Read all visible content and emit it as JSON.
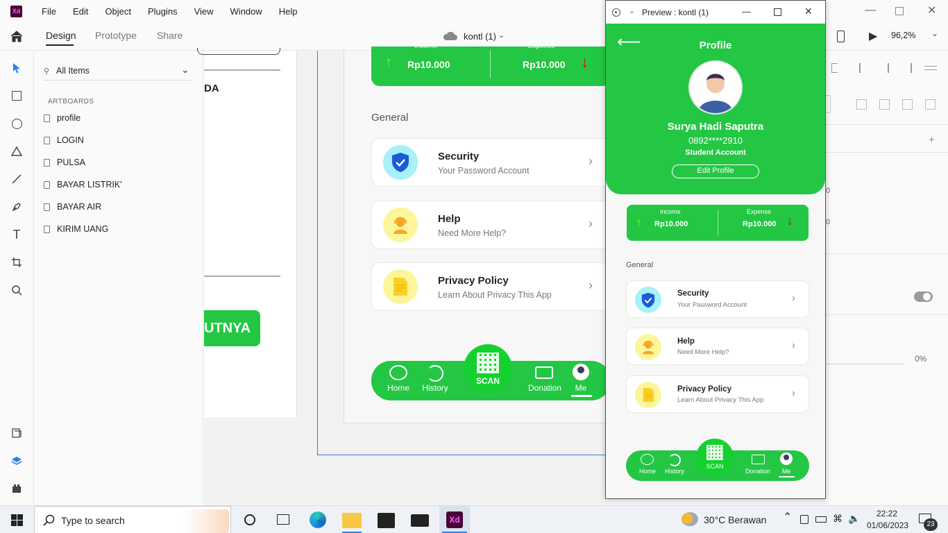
{
  "app": {
    "logo_text": "Xd"
  },
  "menu": [
    "File",
    "Edit",
    "Object",
    "Plugins",
    "View",
    "Window",
    "Help"
  ],
  "toolbar": {
    "tabs": [
      "Design",
      "Prototype",
      "Share"
    ],
    "doc_title": "kontl (1)",
    "zoom": "96,2%"
  },
  "layers": {
    "search_label": "All Items",
    "section": "ARTBOARDS",
    "items": [
      "profile",
      "LOGIN",
      "PULSA",
      "BAYAR LISTRIK'",
      "BAYAR AIR",
      "KIRIM UANG"
    ]
  },
  "artboard_left": {
    "frag_text": "DA",
    "button_text": "UTNYA"
  },
  "artboard_main": {
    "income_label": "Income",
    "expense_label": "Expense",
    "income_value": "Rp10.000",
    "expense_value": "Rp10.000",
    "general": "General",
    "items": [
      {
        "title": "Security",
        "sub": "Your Password Account"
      },
      {
        "title": "Help",
        "sub": "Need More Help?"
      },
      {
        "title": "Privacy Policy",
        "sub": "Learn About Privacy This App"
      }
    ],
    "nav": {
      "home": "Home",
      "history": "History",
      "scan": "SCAN",
      "donation": "Donation",
      "me": "Me"
    }
  },
  "preview": {
    "window_title": "Preview : kontl (1)",
    "header_title": "Profile",
    "name": "Surya Hadi Saputra",
    "phone": "0892****2910",
    "account": "Student Account",
    "edit_button": "Edit Profile"
  },
  "right_panel": {
    "percent": "0%",
    "field1": "0",
    "field2": "0"
  },
  "taskbar": {
    "search_placeholder": "Type to search",
    "weather": "30°C  Berawan",
    "time": "22:22",
    "date": "01/06/2023",
    "notif_count": "23"
  },
  "colors": {
    "green": "#23c744",
    "scan_green": "#15d12f",
    "accent_blue": "#2680eb"
  }
}
